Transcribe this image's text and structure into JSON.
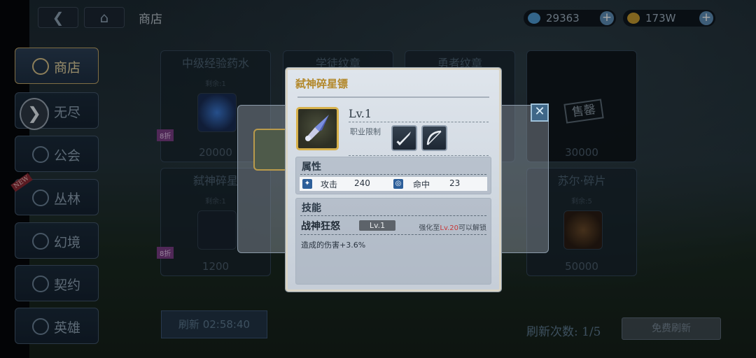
{
  "topbar": {
    "back_icon": "back-arrow-icon",
    "home_icon": "home-icon",
    "title": "商店",
    "currencies": [
      {
        "icon": "diamond-icon",
        "value": "29363"
      },
      {
        "icon": "gold-coin-icon",
        "value": "173W"
      }
    ]
  },
  "sidebar": {
    "items": [
      {
        "label": "商店",
        "active": true
      },
      {
        "label": "无尽"
      },
      {
        "label": "公会"
      },
      {
        "label": "丛林",
        "tag": "NEW"
      },
      {
        "label": "幻境"
      },
      {
        "label": "契约"
      },
      {
        "label": "英雄"
      }
    ]
  },
  "shop": {
    "cards": [
      {
        "title": "中级经验药水",
        "remaining": "剩余:1",
        "price": "20000",
        "discount": "8折"
      },
      {
        "title": "学徒纹章",
        "remaining": "",
        "price": ""
      },
      {
        "title": "勇者纹章",
        "remaining": "",
        "price": ""
      },
      {
        "title": "",
        "remaining": "",
        "price": "30000",
        "sold_out": "售罄"
      },
      {
        "title": "弑神碎星",
        "remaining": "剩余:1",
        "price": "1200",
        "discount": "8折"
      },
      {
        "title": "",
        "remaining": "",
        "price": ""
      },
      {
        "title": "",
        "remaining": "",
        "price": ""
      },
      {
        "title": "苏尔·碎片",
        "remaining": "剩余:5",
        "price": "50000"
      }
    ],
    "refresh_timer": "刷新 02:58:40",
    "refresh_count": "刷新次数: 1/5",
    "free_refresh": "免费刷新"
  },
  "detail": {
    "title": "弑神碎星镖",
    "level": "Lv.1",
    "job_limit": "职业限制",
    "job_icons": [
      "sword-class-icon",
      "bow-class-icon"
    ],
    "attributes_header": "属性",
    "attributes": [
      {
        "icon": "attack-icon",
        "label": "攻击",
        "value": "240"
      },
      {
        "icon": "accuracy-icon",
        "label": "命中",
        "value": "23"
      }
    ],
    "skills_header": "技能",
    "skill_name": "战神狂怒",
    "skill_level": "Lv.1",
    "unlock_prefix": "强化至",
    "unlock_level": "Lv.20",
    "unlock_suffix": "可以解锁",
    "skill_desc": "造成的伤害+3.6%"
  },
  "colors": {
    "accent_gold": "#b3882a",
    "panel_bg": "#dfe5ec",
    "unlock_red": "#c73838"
  }
}
